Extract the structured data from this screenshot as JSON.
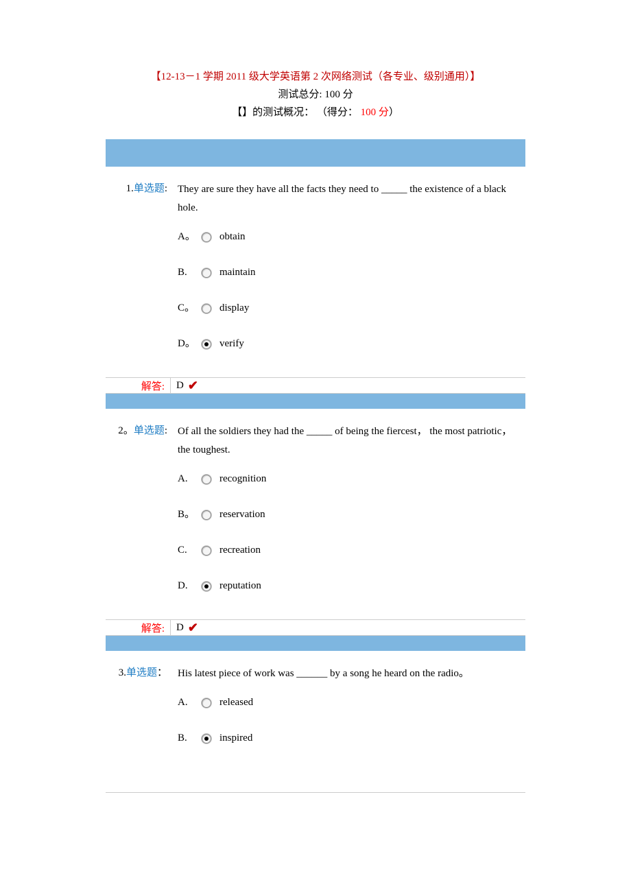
{
  "header": {
    "title": "【12-13－1 学期 2011 级大学英语第 2 次网络测试（各专业、级别通用）】",
    "total": "测试总分: 100 分",
    "score_prefix": "【】的测试概况： （得分： ",
    "score_value": "100 分",
    "score_suffix": "）"
  },
  "answer_label": "解答:",
  "qtype_label": "单选题",
  "questions": [
    {
      "number": "1.",
      "number_sep": ":",
      "stem": "They are sure they have all the facts they need to _____ the existence of a black hole.",
      "options": [
        {
          "letter": "A。",
          "text": "obtain",
          "checked": false
        },
        {
          "letter": "B.",
          "text": "maintain",
          "checked": false
        },
        {
          "letter": "C。",
          "text": "display",
          "checked": false
        },
        {
          "letter": "D。",
          "text": "verify",
          "checked": true
        }
      ],
      "answer": "D"
    },
    {
      "number": "2。",
      "number_sep": ":",
      "stem": "Of all the soldiers they had the _____ of being the fiercest，  the most patriotic，  the toughest.",
      "options": [
        {
          "letter": "A.",
          "text": "recognition",
          "checked": false
        },
        {
          "letter": "B。",
          "text": "reservation",
          "checked": false
        },
        {
          "letter": "C.",
          "text": "recreation",
          "checked": false
        },
        {
          "letter": "D.",
          "text": "reputation",
          "checked": true
        }
      ],
      "answer": "D"
    },
    {
      "number": "3.",
      "number_sep": "：",
      "stem": "His latest piece of work was ______ by a song he heard on the radio。",
      "options": [
        {
          "letter": "A.",
          "text": "released",
          "checked": false
        },
        {
          "letter": "B.",
          "text": "inspired",
          "checked": true
        }
      ],
      "answer": null
    }
  ]
}
